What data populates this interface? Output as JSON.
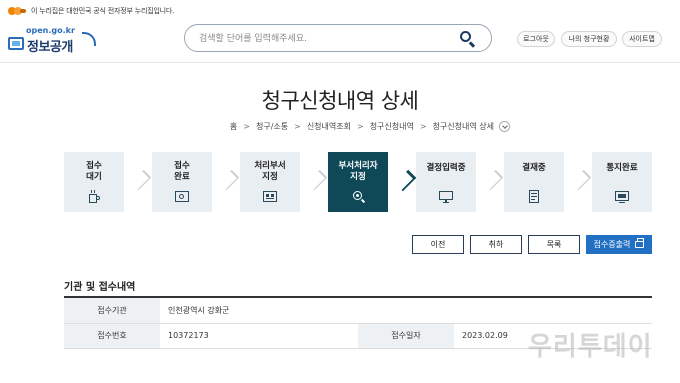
{
  "gov_notice": "이 누리집은 대한민국 공식 전자정부 누리집입니다.",
  "logo": {
    "url_text": "open.go.kr",
    "name": "정보공개"
  },
  "search": {
    "placeholder": "검색할 단어를 입력해주세요."
  },
  "util_links": {
    "logout": "로그아웃",
    "my_requests": "나의 청구현황",
    "sitemap": "사이트맵"
  },
  "page_title": "청구신청내역 상세",
  "breadcrumb": [
    "홈",
    "청구/소통",
    "신청내역조회",
    "청구신청내역",
    "청구신청내역 상세"
  ],
  "steps": [
    {
      "line1": "접수",
      "line2": "대기",
      "icon": "mug-icon"
    },
    {
      "line1": "접수",
      "line2": "완료",
      "icon": "registered-screen-icon"
    },
    {
      "line1": "처리부서",
      "line2": "지정",
      "icon": "org-chart-icon"
    },
    {
      "line1": "부서처리자",
      "line2": "지정",
      "icon": "person-search-icon",
      "active": true
    },
    {
      "line1": "결정입력중",
      "line2": "",
      "icon": "monitor-icon"
    },
    {
      "line1": "결재중",
      "line2": "",
      "icon": "document-icon"
    },
    {
      "line1": "통지완료",
      "line2": "",
      "icon": "notice-screen-icon"
    }
  ],
  "buttons": {
    "prev": "이전",
    "cancel": "취하",
    "list": "목록",
    "print": "접수증출력"
  },
  "section": {
    "title": "기관 및 접수내역",
    "agency_label": "접수기관",
    "agency_value": "인천광역시 강화군",
    "receipt_no_label": "접수번호",
    "receipt_no_value": "10372173",
    "receipt_date_label": "접수일자",
    "receipt_date_value": "2023.02.09"
  },
  "watermark": "우리투데이",
  "colors": {
    "active_step": "#0f4957",
    "step_bg": "#e8eef2",
    "primary_button": "#2170c4"
  }
}
